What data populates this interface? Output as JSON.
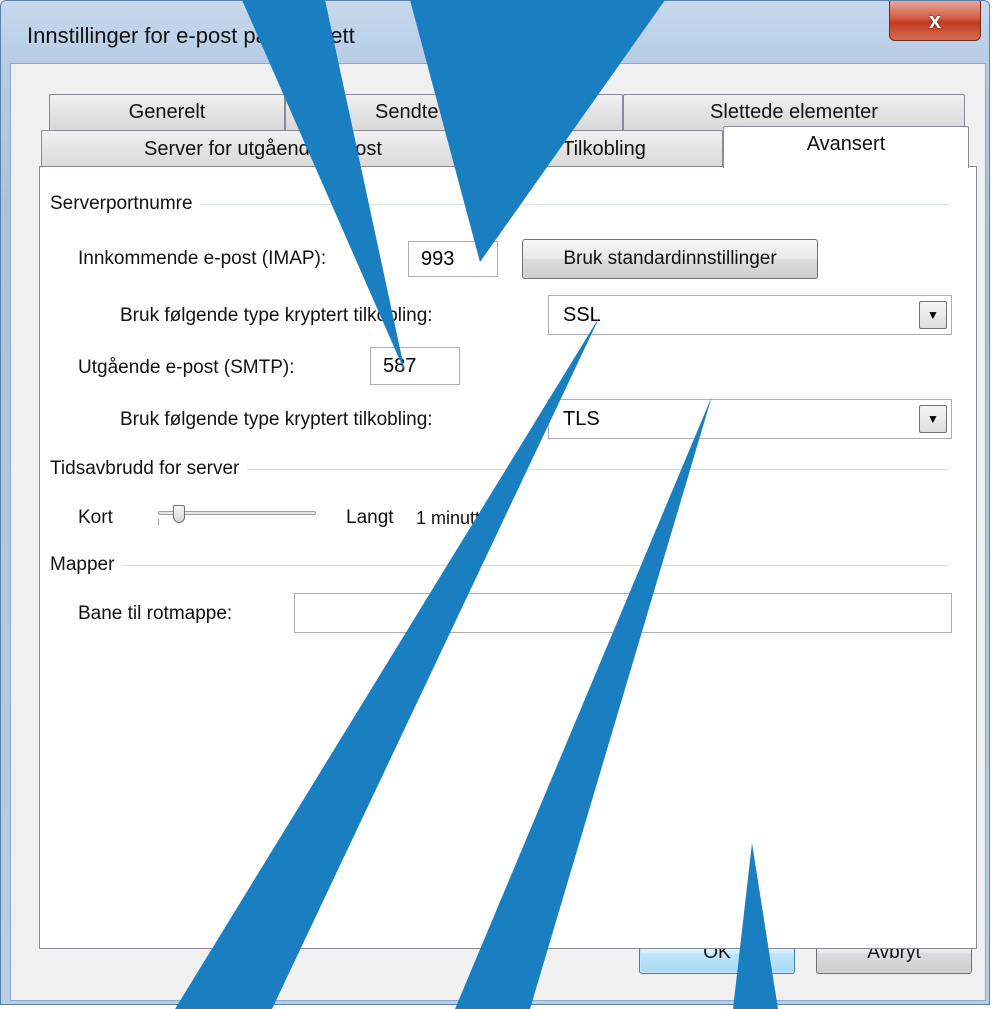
{
  "window": {
    "title": "Innstillinger for e-post på Internett",
    "close_glyph": "x"
  },
  "tabs": {
    "row1": [
      "Generelt",
      "Sendte elementer",
      "Slettede elementer"
    ],
    "row2": [
      "Server for utgående e-post",
      "Tilkobling",
      "Avansert"
    ],
    "active": "Avansert"
  },
  "server_ports": {
    "group_label": "Serverportnumre",
    "incoming_label": "Innkommende e-post (IMAP):",
    "incoming_value": "993",
    "defaults_button": "Bruk standardinnstillinger",
    "incoming_encryption_label": "Bruk følgende type kryptert tilkobling:",
    "incoming_encryption_value": "SSL",
    "outgoing_label": "Utgående e-post (SMTP):",
    "outgoing_value": "587",
    "outgoing_encryption_label": "Bruk følgende type kryptert tilkobling:",
    "outgoing_encryption_value": "TLS"
  },
  "timeout": {
    "group_label": "Tidsavbrudd for server",
    "short_label": "Kort",
    "long_label": "Langt",
    "value_text": "1 minutt",
    "slider_fraction": 0.1
  },
  "folders": {
    "group_label": "Mapper",
    "root_folder_label": "Bane til rotmappe:",
    "root_folder_value": ""
  },
  "footer": {
    "ok_button": "OK",
    "cancel_button": "Avbryt"
  },
  "colors": {
    "annotation_arrow": "#1a7fc1"
  }
}
